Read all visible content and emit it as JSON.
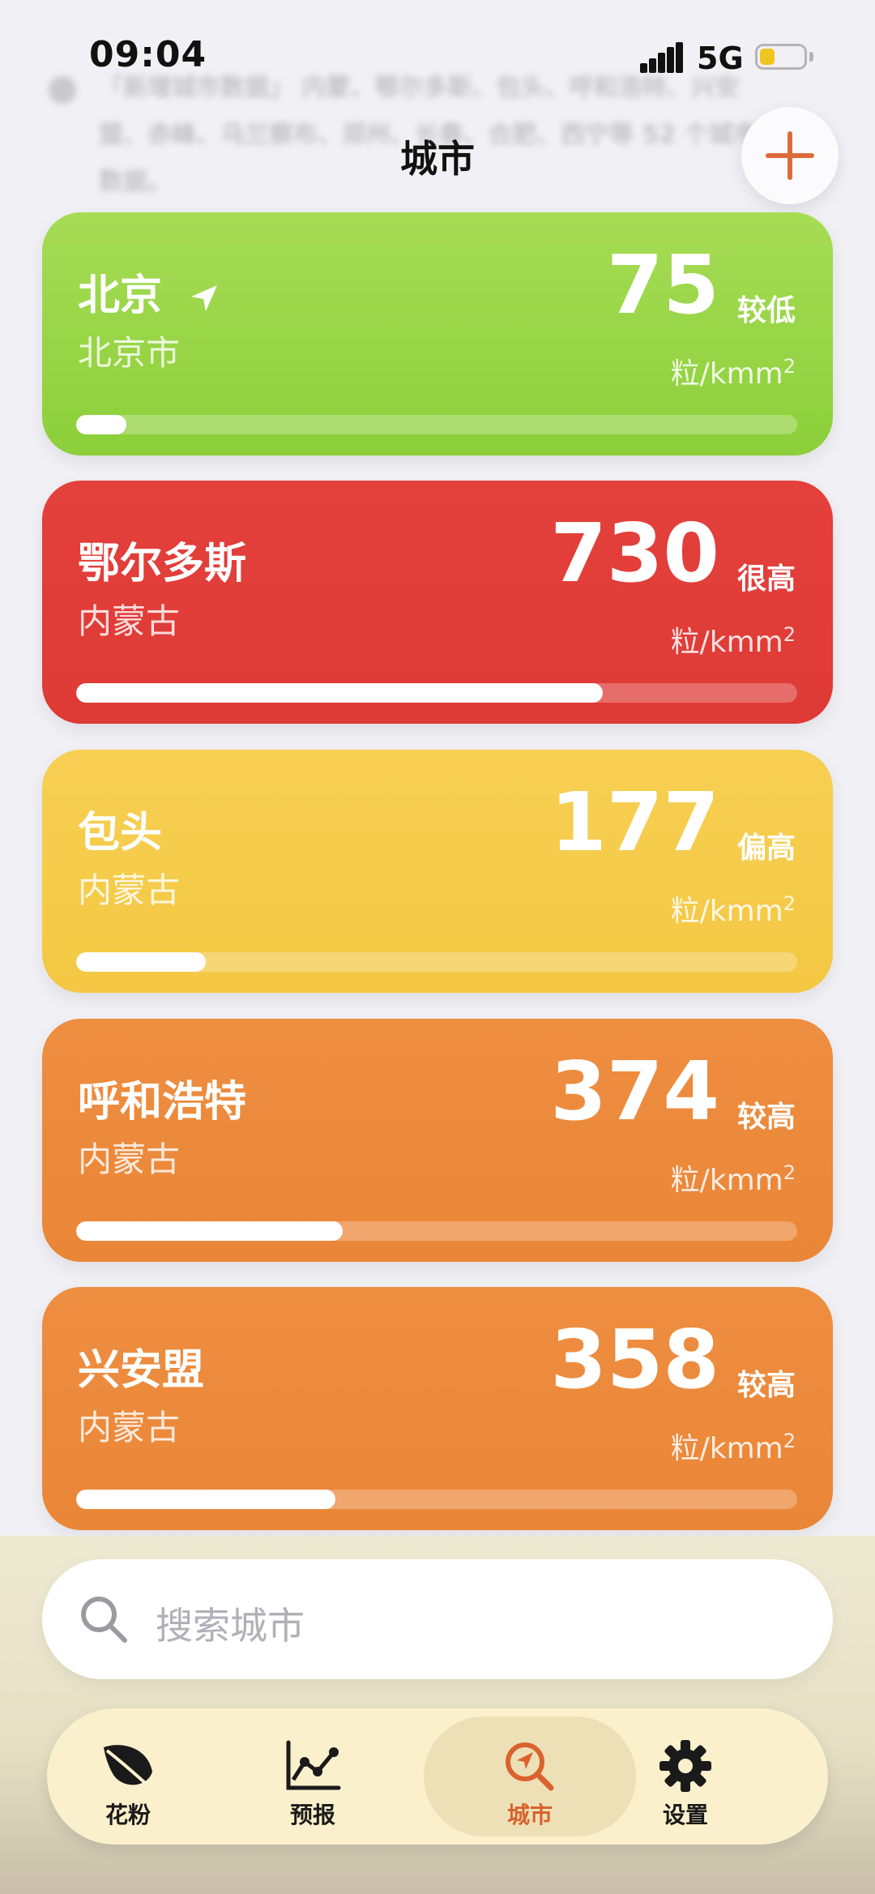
{
  "status_bar": {
    "time": "09:04",
    "network": "5G"
  },
  "notice": {
    "text": "「新增城市数据」 内蒙、鄂尔多斯、包头、呼和浩特、兴安盟、赤峰、乌兰察布、郑州、长春、合肥、西宁等 52 个城市数据。"
  },
  "header": {
    "title": "城市"
  },
  "cities": [
    {
      "name": "北京",
      "region": "北京市",
      "value": "75",
      "level": "较低",
      "unit": "粒/kmm",
      "unit_sup": "2",
      "fill": 0.07,
      "color": "#97d444",
      "current_location": true
    },
    {
      "name": "鄂尔多斯",
      "region": "内蒙古",
      "value": "730",
      "level": "很高",
      "unit": "粒/kmm",
      "unit_sup": "2",
      "fill": 0.73,
      "color": "#e03d39"
    },
    {
      "name": "包头",
      "region": "内蒙古",
      "value": "177",
      "level": "偏高",
      "unit": "粒/kmm",
      "unit_sup": "2",
      "fill": 0.18,
      "color": "#f6cb4a"
    },
    {
      "name": "呼和浩特",
      "region": "内蒙古",
      "value": "374",
      "level": "较高",
      "unit": "粒/kmm",
      "unit_sup": "2",
      "fill": 0.37,
      "color": "#ec8a3c"
    },
    {
      "name": "兴安盟",
      "region": "内蒙古",
      "value": "358",
      "level": "较高",
      "unit": "粒/kmm",
      "unit_sup": "2",
      "fill": 0.36,
      "color": "#ec8a3c"
    }
  ],
  "search": {
    "placeholder": "搜索城市"
  },
  "tabs": [
    {
      "label": "花粉",
      "icon": "leaf-icon",
      "active": false
    },
    {
      "label": "预报",
      "icon": "chart-line-icon",
      "active": false
    },
    {
      "label": "城市",
      "icon": "location-search-icon",
      "active": true
    },
    {
      "label": "设置",
      "icon": "gear-icon",
      "active": false
    }
  ],
  "colors": {
    "accent": "#d9622f",
    "tab_bar": "#fbf0cc",
    "tab_active_bg": "#ede0b6"
  }
}
